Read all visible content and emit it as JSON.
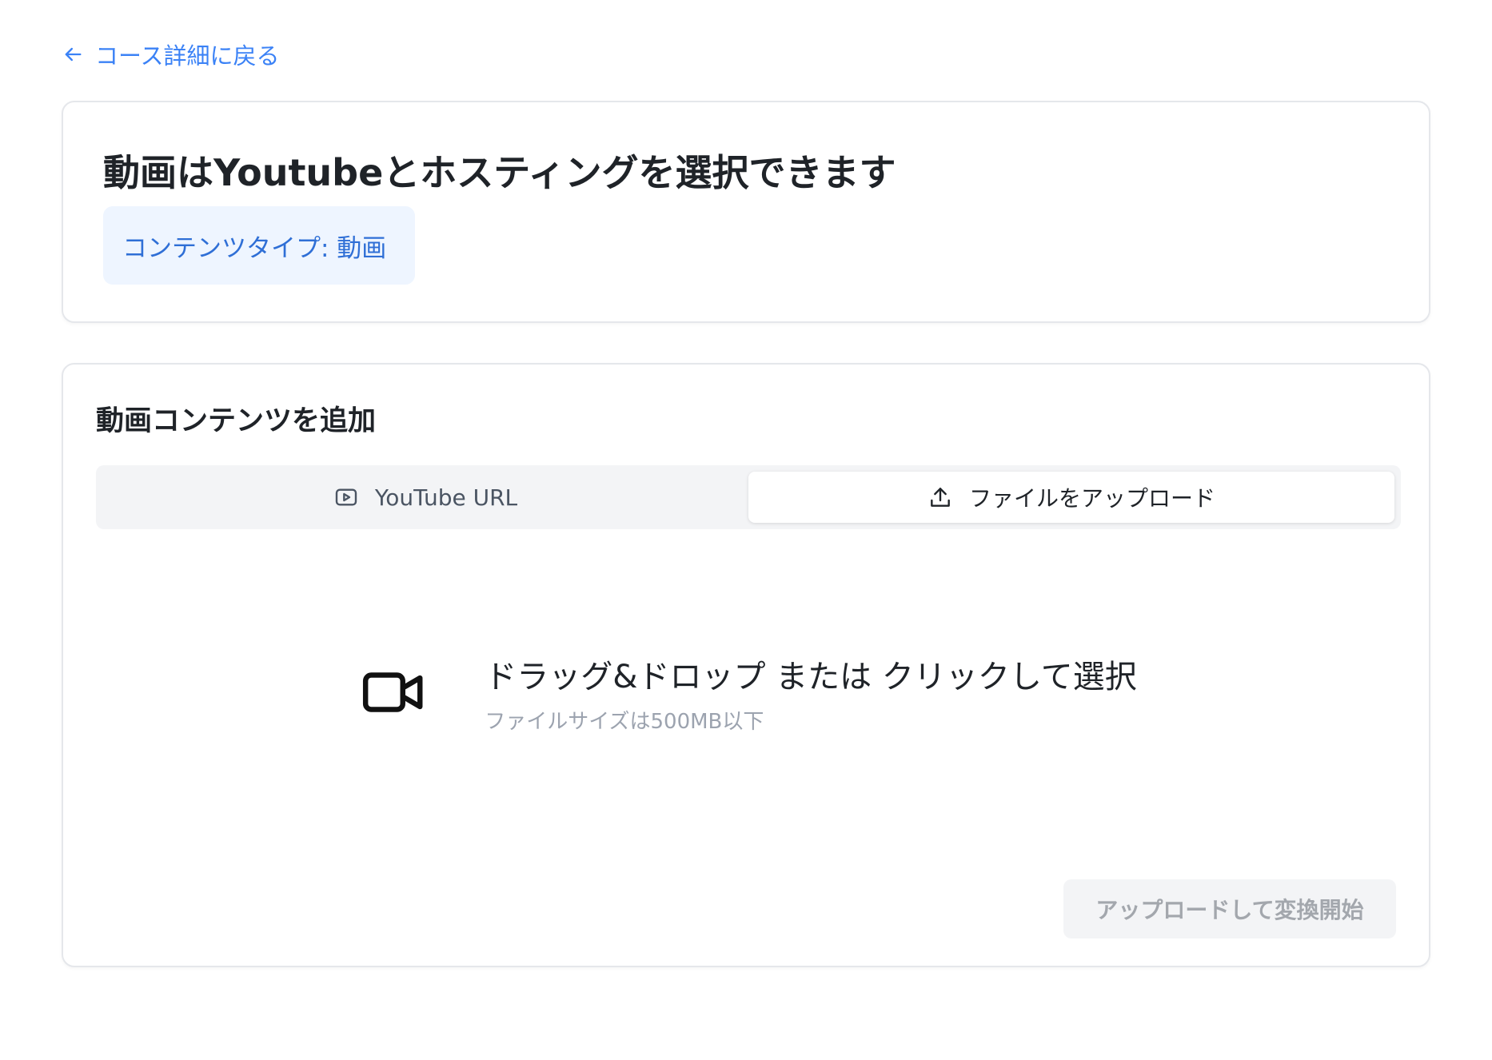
{
  "nav": {
    "back_label": "コース詳細に戻る"
  },
  "info_card": {
    "title": "動画はYoutubeとホスティングを選択できます",
    "content_type_badge": "コンテンツタイプ: 動画"
  },
  "upload_card": {
    "title": "動画コンテンツを追加",
    "tabs": [
      {
        "label": "YouTube URL",
        "icon": "youtube-play-icon",
        "active": false
      },
      {
        "label": "ファイルをアップロード",
        "icon": "upload-icon",
        "active": true
      }
    ],
    "dropzone": {
      "icon": "video-camera-icon",
      "main_text": "ドラッグ&ドロップ または クリックして選択",
      "sub_text": "ファイルサイズは500MB以下"
    },
    "submit_label": "アップロードして変換開始",
    "submit_disabled": true
  },
  "colors": {
    "link": "#3b82f6",
    "badge_bg": "#eef5ff",
    "badge_text": "#2f6fd6",
    "border": "#e5e7eb",
    "tabs_bg": "#f3f4f6"
  }
}
